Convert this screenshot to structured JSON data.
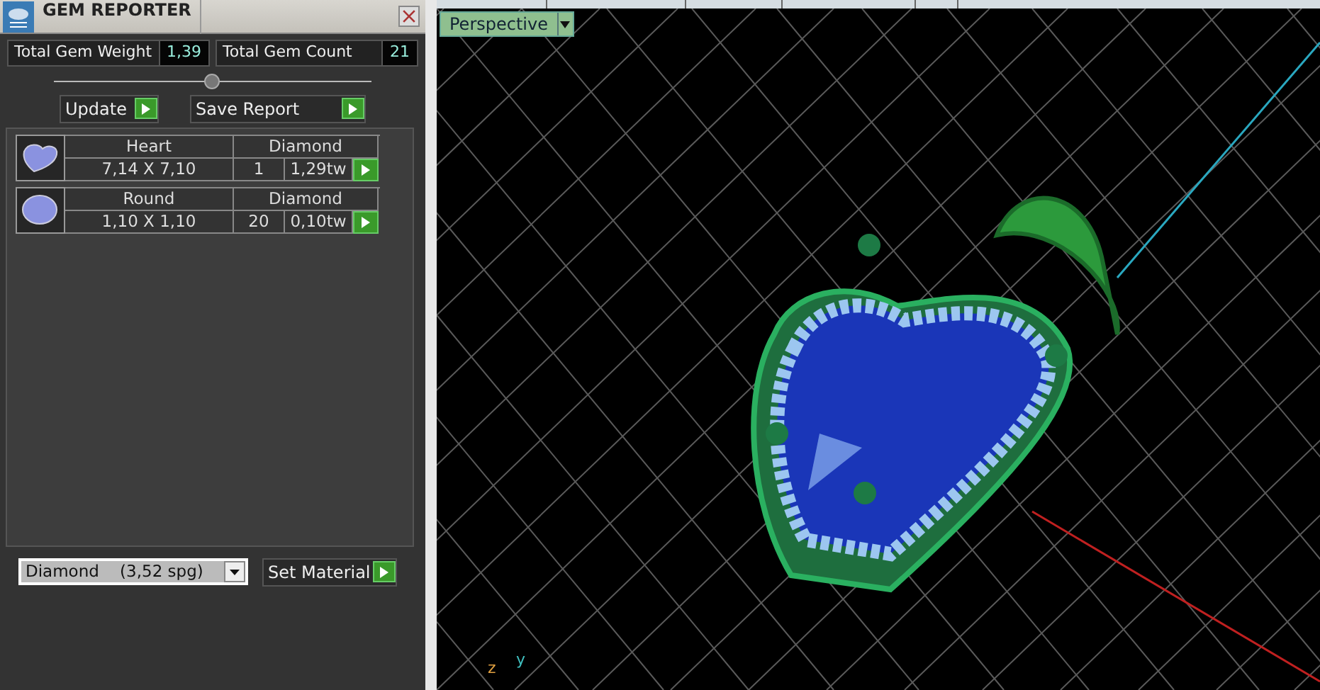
{
  "panel": {
    "title": "GEM REPORTER",
    "totals": [
      {
        "label": "Total Gem Weight",
        "value": "1,39"
      },
      {
        "label": "Total Gem Count",
        "value": "21"
      }
    ],
    "actions": [
      "Update",
      "Save Report"
    ],
    "gems": [
      {
        "kind": "heart",
        "shape": "Heart",
        "size": "7,14 X 7,10",
        "material": "Diamond",
        "count": "1",
        "weight": "1,29tw"
      },
      {
        "kind": "round",
        "shape": "Round",
        "size": "1,10 X 1,10",
        "material": "Diamond",
        "count": "20",
        "weight": "0,10tw"
      }
    ],
    "material_select": {
      "value": "Diamond    (3,52 spg)"
    },
    "set_button": "Set Material"
  },
  "viewport": {
    "view_menu": "Perspective",
    "axes": [
      {
        "kind": "z",
        "label": "z"
      },
      {
        "kind": "y",
        "label": "y"
      }
    ]
  }
}
